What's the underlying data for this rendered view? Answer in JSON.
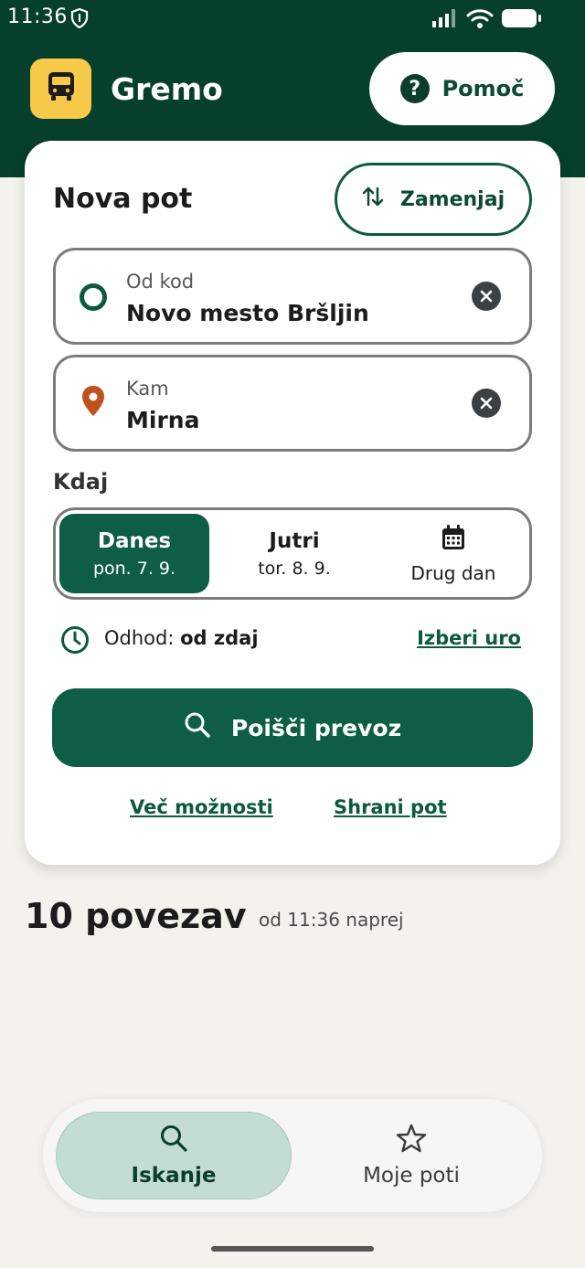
{
  "status_bar": {
    "time": "11:36",
    "icons": [
      "shield-icon",
      "signal-icon",
      "wifi-icon",
      "battery-icon"
    ]
  },
  "header": {
    "app_name": "Gremo",
    "logo_icon": "bus-icon",
    "help_label": "Pomoč",
    "colors": {
      "background": "#063f2c",
      "logo": "#f7c948"
    }
  },
  "route_card": {
    "title": "Nova pot",
    "swap_label": "Zamenjaj",
    "from": {
      "label": "Od kod",
      "value": "Novo mesto Bršljin"
    },
    "to": {
      "label": "Kam",
      "value": "Mirna"
    },
    "when_label": "Kdaj",
    "days": [
      {
        "name": "Danes",
        "date": "pon. 7. 9.",
        "selected": true
      },
      {
        "name": "Jutri",
        "date": "tor. 8. 9.",
        "selected": false
      },
      {
        "name": "",
        "date": "Drug dan",
        "selected": false,
        "icon": "calendar-icon"
      }
    ],
    "departure": {
      "prefix": "Odhod:",
      "value": "od zdaj",
      "pick_time": "Izberi uro"
    },
    "search_label": "Poišči prevoz",
    "more_options": "Več možnosti",
    "save_route": "Shrani pot"
  },
  "results": {
    "count": "10 povezav",
    "since": "od 11:36 naprej"
  },
  "bottom_nav": {
    "items": [
      {
        "label": "Iskanje",
        "icon": "search-icon",
        "active": true
      },
      {
        "label": "Moje poti",
        "icon": "star-icon",
        "active": false
      }
    ]
  },
  "colors": {
    "primary": "#0d5e44",
    "accent_orange": "#c0511c",
    "page_background": "#f3f2ec"
  }
}
